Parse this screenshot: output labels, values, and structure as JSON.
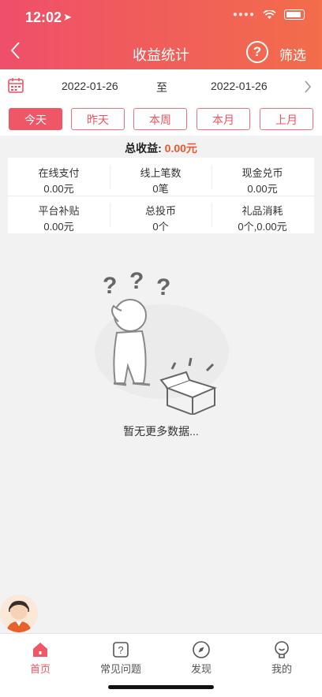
{
  "status": {
    "time": "12:02"
  },
  "header": {
    "title": "收益统计",
    "filter_label": "筛选",
    "help_glyph": "?"
  },
  "date_range": {
    "start": "2022-01-26",
    "separator": "至",
    "end": "2022-01-26"
  },
  "range_tabs": [
    "今天",
    "昨天",
    "本周",
    "本月",
    "上月"
  ],
  "active_range": "今天",
  "total": {
    "label": "总收益:",
    "value": "0.00元"
  },
  "stats": [
    {
      "label": "在线支付",
      "value": "0.00元"
    },
    {
      "label": "线上笔数",
      "value": "0笔"
    },
    {
      "label": "现金兑币",
      "value": "0.00元"
    },
    {
      "label": "平台补贴",
      "value": "0.00元"
    },
    {
      "label": "总投币",
      "value": "0个"
    },
    {
      "label": "礼品消耗",
      "value": "0个,0.00元"
    }
  ],
  "empty": {
    "text": "暂无更多数据..."
  },
  "tabbar": [
    {
      "label": "首页",
      "icon": "home-icon"
    },
    {
      "label": "常见问题",
      "icon": "faq-icon"
    },
    {
      "label": "发现",
      "icon": "compass-icon"
    },
    {
      "label": "我的",
      "icon": "profile-icon"
    }
  ],
  "colors": {
    "accent": "#ef5666",
    "amount": "#f0552a"
  }
}
